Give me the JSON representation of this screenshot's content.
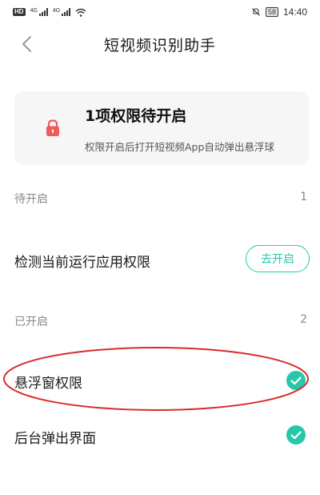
{
  "status_bar": {
    "hd_label": "HD",
    "network_1": "4G",
    "network_2": "4G",
    "battery": "58",
    "time": "14:40"
  },
  "header": {
    "title": "短视频识别助手"
  },
  "card": {
    "title": "1项权限待开启",
    "subtitle": "权限开启后打开短视频App自动弹出悬浮球"
  },
  "pending": {
    "label": "待开启",
    "count": "1",
    "items": [
      {
        "label": "检测当前运行应用权限",
        "button_label": "去开启"
      }
    ]
  },
  "enabled": {
    "label": "已开启",
    "count": "2",
    "items": [
      {
        "label": "悬浮窗权限"
      },
      {
        "label": "后台弹出界面"
      }
    ]
  },
  "colors": {
    "accent": "#27c7ac",
    "lock": "#f05a5a",
    "annotation": "#d92b2b"
  }
}
